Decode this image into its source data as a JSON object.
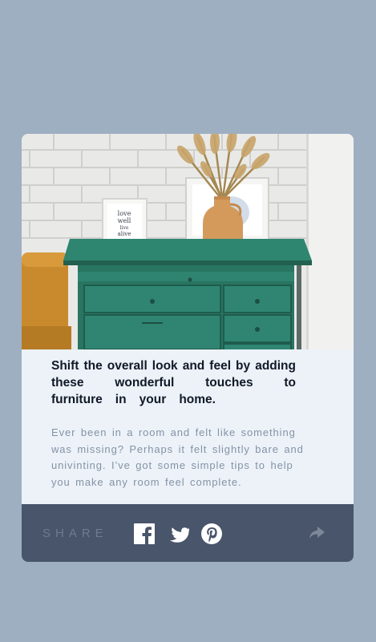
{
  "article": {
    "headline_lines": "Shift the overall look and feel by adding these wonderful touches to",
    "headline_last": "furniture in your home.",
    "description": "Ever been in a room and felt like something was missing? Perhaps it felt slightly bare and univinting. I’ve got some simple tips to help you make any room feel complete.",
    "frame_text": "love well live alive"
  },
  "share": {
    "label": "SHARE",
    "networks": [
      "facebook-icon",
      "twitter-icon",
      "pinterest-icon",
      "share-icon"
    ]
  },
  "colors": {
    "background": "#9eafc2",
    "card": "#ecf2f8",
    "footer": "#48556a",
    "dresser": "#2e7d68"
  }
}
